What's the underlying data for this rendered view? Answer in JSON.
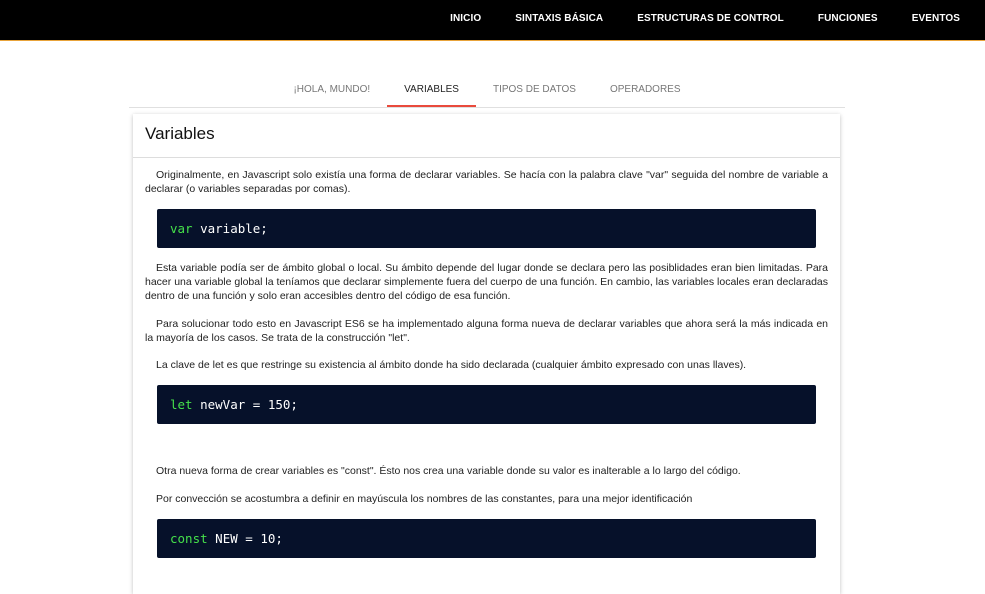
{
  "nav": {
    "items": [
      "INICIO",
      "SINTAXIS BÁSICA",
      "ESTRUCTURAS DE CONTROL",
      "FUNCIONES",
      "EVENTOS"
    ]
  },
  "tabs": [
    {
      "label": "¡HOLA, MUNDO!",
      "active": false
    },
    {
      "label": "VARIABLES",
      "active": true
    },
    {
      "label": "TIPOS DE DATOS",
      "active": false
    },
    {
      "label": "OPERADORES",
      "active": false
    }
  ],
  "card": {
    "title": "Variables",
    "p1": "Originalmente, en Javascript solo existía una forma de declarar variables. Se hacía con la palabra clave \"var\" seguida del nombre de variable a declarar (o variables separadas por comas).",
    "code1": {
      "keyword": "var",
      "rest": " variable;"
    },
    "p2": "Esta variable podía ser de ámbito global o local. Su ámbito depende del lugar donde se declara pero las posiblidades eran bien limitadas. Para hacer una variable global la teníamos que declarar simplemente fuera del cuerpo de una función. En cambio, las variables locales eran declaradas dentro de una función y solo eran accesibles dentro del código de esa función.",
    "p3": "Para solucionar todo esto en Javascript ES6 se ha implementado alguna forma nueva de declarar variables que ahora será la más indicada en la mayoría de los casos. Se trata de la construcción \"let\".",
    "p4": "La clave de let es que restringe su existencia al ámbito donde ha sido declarada (cualquier ámbito expresado con unas llaves).",
    "code2": {
      "keyword": "let",
      "rest": " newVar = 150;"
    },
    "p5": "Otra nueva forma de crear variables es \"const\". Ésto nos crea una variable donde su valor es inalterable a lo largo del código.",
    "p6": "Por convección se acostumbra a definir en mayúscula los nombres de las constantes, para una mejor identificación",
    "code3": {
      "keyword": "const",
      "rest": " NEW = 10;"
    }
  },
  "colors": {
    "topbar": "#000000",
    "topbar_border": "#e8a33a",
    "tab_active_underline": "#e94a3c",
    "code_bg": "#06112a",
    "code_keyword": "#45e04a"
  }
}
